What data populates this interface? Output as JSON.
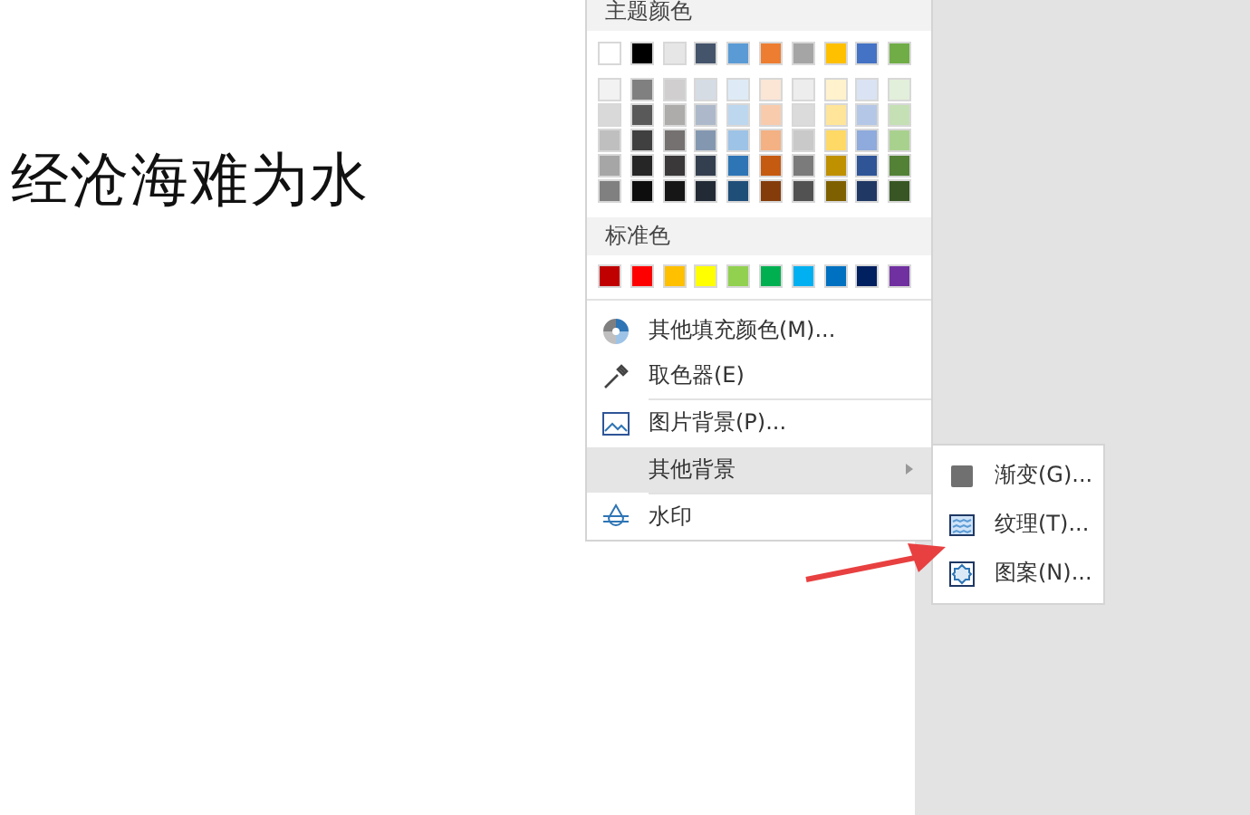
{
  "document": {
    "text": "经沧海难为水"
  },
  "menu": {
    "theme_title": "主题颜色",
    "theme_colors": [
      {
        "color": "#ffffff"
      },
      {
        "color": "#000000"
      },
      {
        "color": "#e7e6e6"
      },
      {
        "color": "#44546a"
      },
      {
        "color": "#5b9bd5"
      },
      {
        "color": "#ed7d31"
      },
      {
        "color": "#a5a5a5"
      },
      {
        "color": "#ffc000"
      },
      {
        "color": "#4472c4"
      },
      {
        "color": "#70ad47"
      }
    ],
    "shade_rows": [
      [
        {
          "color": "#f2f2f2"
        },
        {
          "color": "#808080"
        },
        {
          "color": "#d0cece"
        },
        {
          "color": "#d6dce4"
        },
        {
          "color": "#deebf6"
        },
        {
          "color": "#fbe5d5"
        },
        {
          "color": "#ededed"
        },
        {
          "color": "#fff2cc"
        },
        {
          "color": "#dae3f3"
        },
        {
          "color": "#e2efda"
        }
      ],
      [
        {
          "color": "#d9d9d9"
        },
        {
          "color": "#595959"
        },
        {
          "color": "#aeabab"
        },
        {
          "color": "#adb9ca"
        },
        {
          "color": "#bdd7ee"
        },
        {
          "color": "#f8cbad"
        },
        {
          "color": "#dbdbdb"
        },
        {
          "color": "#fee599"
        },
        {
          "color": "#b4c7e7"
        },
        {
          "color": "#c5e0b4"
        }
      ],
      [
        {
          "color": "#bfbfbf"
        },
        {
          "color": "#404040"
        },
        {
          "color": "#757171"
        },
        {
          "color": "#8497b0"
        },
        {
          "color": "#9dc3e6"
        },
        {
          "color": "#f4b183"
        },
        {
          "color": "#c9c9c9"
        },
        {
          "color": "#ffd965"
        },
        {
          "color": "#8faadc"
        },
        {
          "color": "#a9d18e"
        }
      ],
      [
        {
          "color": "#a6a6a6"
        },
        {
          "color": "#262626"
        },
        {
          "color": "#3a3838"
        },
        {
          "color": "#333f4f"
        },
        {
          "color": "#2e75b5"
        },
        {
          "color": "#c55a11"
        },
        {
          "color": "#7b7b7b"
        },
        {
          "color": "#bf9000"
        },
        {
          "color": "#2f5597"
        },
        {
          "color": "#538135"
        }
      ],
      [
        {
          "color": "#808080"
        },
        {
          "color": "#0d0d0d"
        },
        {
          "color": "#171616"
        },
        {
          "color": "#222a35"
        },
        {
          "color": "#1f4e79"
        },
        {
          "color": "#843c0b"
        },
        {
          "color": "#525252"
        },
        {
          "color": "#7f6000"
        },
        {
          "color": "#203864"
        },
        {
          "color": "#375623"
        }
      ]
    ],
    "standard_title": "标准色",
    "standard_colors": [
      {
        "color": "#c00000"
      },
      {
        "color": "#ff0000"
      },
      {
        "color": "#ffc000"
      },
      {
        "color": "#ffff00"
      },
      {
        "color": "#92d050"
      },
      {
        "color": "#00b050"
      },
      {
        "color": "#00b0f0"
      },
      {
        "color": "#0070c0"
      },
      {
        "color": "#002060"
      },
      {
        "color": "#7030a0"
      }
    ],
    "items": [
      {
        "label": "其他填充颜色(M)...",
        "kind": "action",
        "selected": false,
        "divider_before": true
      },
      {
        "label": "取色器(E)",
        "kind": "action",
        "selected": false,
        "divider_before": false
      },
      {
        "label": "图片背景(P)...",
        "kind": "action",
        "selected": false,
        "divider_before": true
      },
      {
        "label": "其他背景",
        "kind": "submenu",
        "selected": true,
        "divider_before": false
      },
      {
        "label": "水印",
        "kind": "action",
        "selected": false,
        "divider_before": true
      }
    ]
  },
  "submenu": {
    "items": [
      {
        "label": "渐变(G)..."
      },
      {
        "label": "纹理(T)..."
      },
      {
        "label": "图案(N)..."
      }
    ]
  }
}
